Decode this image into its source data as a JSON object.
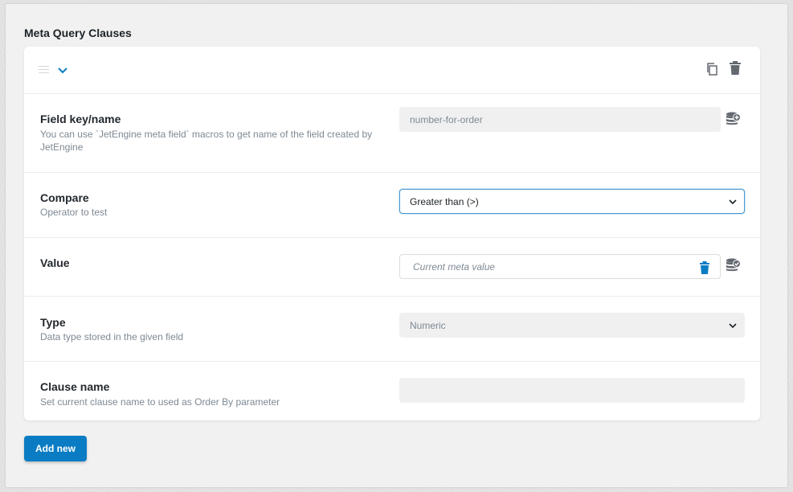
{
  "section": {
    "title": "Meta Query Clauses"
  },
  "clause": {
    "rows": {
      "field_key": {
        "label": "Field key/name",
        "description": "You can use `JetEngine meta field` macros to get name of the field created by JetEngine",
        "placeholder": "number-for-order",
        "value": ""
      },
      "compare": {
        "label": "Compare",
        "description": "Operator to test",
        "selected": "Greater than (>)"
      },
      "value": {
        "label": "Value",
        "value": "Current meta value"
      },
      "type": {
        "label": "Type",
        "description": "Data type stored in the given field",
        "selected": "Numeric"
      },
      "clause_name": {
        "label": "Clause name",
        "description": "Set current clause name to used as Order By parameter",
        "value": ""
      }
    }
  },
  "actions": {
    "add_new": "Add new"
  },
  "colors": {
    "accent": "#0a7cc4",
    "icon_gray": "#646970"
  },
  "icons": [
    "drag-handle-icon",
    "chevron-down-icon",
    "copy-icon",
    "trash-icon",
    "database-icon"
  ]
}
